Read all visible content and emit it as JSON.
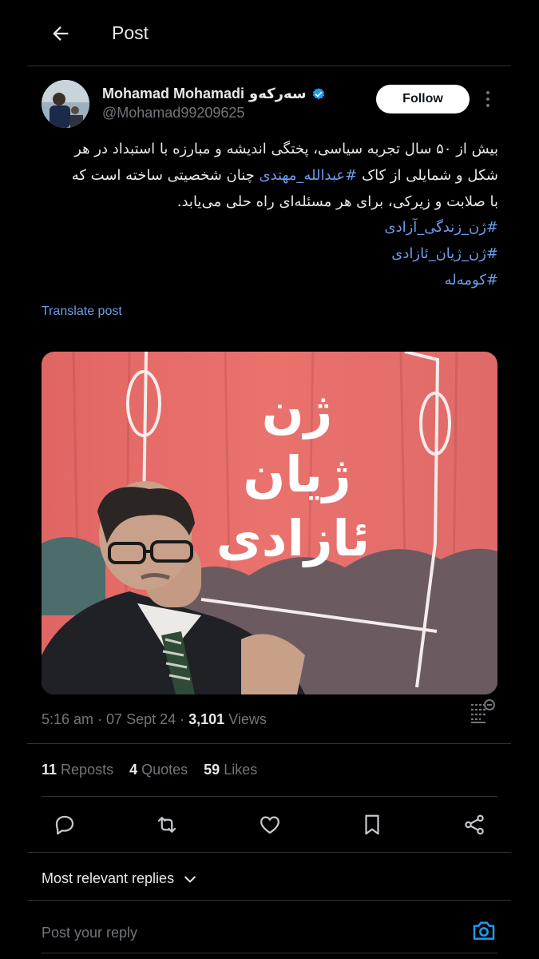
{
  "header": {
    "title": "Post"
  },
  "author": {
    "name": "Mohamad Mohamadi",
    "name_suffix": "سەرکەو",
    "handle": "@Mohamad99209625",
    "verified_color": "#1d9bf0"
  },
  "follow_label": "Follow",
  "post": {
    "line1": "بیش از ۵۰ سال تجربه سیاسی، پختگی اندیشه و مبارزه با استبداد در هر",
    "line2_before": "شکل و شمایلی از کاک ",
    "line2_mention": "#عبدالله_مهتدی",
    "line2_after": " چنان شخصیتی ساخته است که",
    "line3": "با صلابت و زیرکی، برای هر مسئله‌ای راه حلی  می‌یابد.",
    "hashtags": [
      "#ژن_زندگی_آزادی",
      "#ژن_ژیان_ئازادی",
      "#کومەلە"
    ]
  },
  "translate_label": "Translate post",
  "media": {
    "banner_lines": [
      "ژن",
      "ژیان",
      "ئازادی"
    ],
    "banner_color": "#e46a66"
  },
  "meta": {
    "time": "5:16 am",
    "date": "07 Sept 24",
    "views_count": "3,101",
    "views_label": "Views"
  },
  "stats": {
    "reposts_count": "11",
    "reposts_label": "Reposts",
    "quotes_count": "4",
    "quotes_label": "Quotes",
    "likes_count": "59",
    "likes_label": "Likes"
  },
  "replies": {
    "sort_label": "Most relevant replies",
    "input_placeholder": "Post your reply"
  },
  "colors": {
    "accent": "#6d9eeb",
    "muted": "#71767b",
    "divider": "#2f3336",
    "background": "#000000"
  }
}
